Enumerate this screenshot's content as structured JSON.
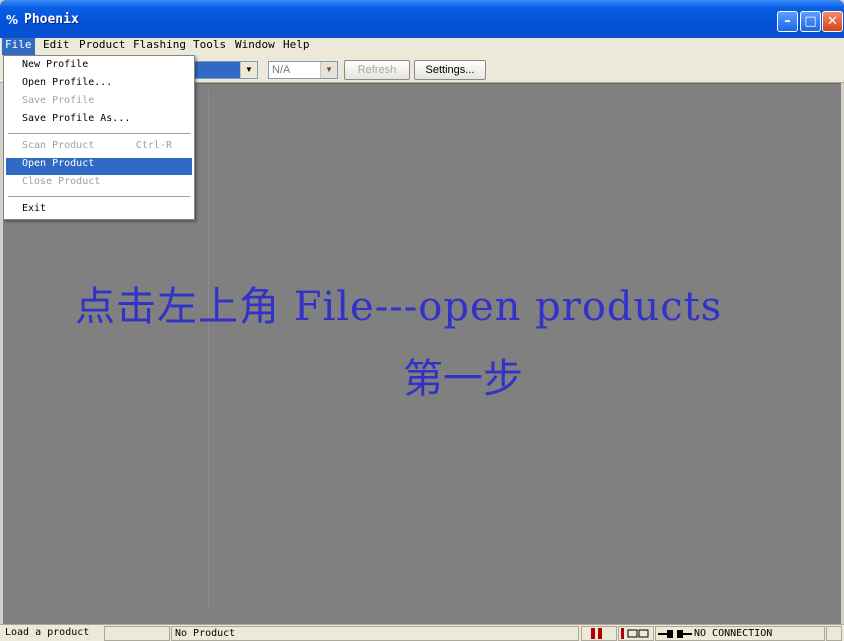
{
  "window": {
    "title": "Phoenix",
    "icon_text": "%"
  },
  "menubar": [
    {
      "label": "File",
      "active": true
    },
    {
      "label": "Edit"
    },
    {
      "label": "Product"
    },
    {
      "label": "Flashing"
    },
    {
      "label": "Tools"
    },
    {
      "label": "Window"
    },
    {
      "label": "Help"
    }
  ],
  "toolbar": {
    "port_value": "N/A",
    "refresh_label": "Refresh",
    "settings_label": "Settings..."
  },
  "file_menu": {
    "items": [
      {
        "label": "New Profile",
        "disabled": false
      },
      {
        "label": "Open Profile...",
        "disabled": false
      },
      {
        "label": "Save Profile",
        "disabled": true
      },
      {
        "label": "Save Profile As...",
        "disabled": false
      },
      {
        "label": "Scan Product",
        "shortcut": "Ctrl-R",
        "disabled": true
      },
      {
        "label": "Open Product",
        "disabled": false,
        "highlighted": true
      },
      {
        "label": "Close Product",
        "disabled": true
      },
      {
        "label": "Exit",
        "disabled": false
      }
    ]
  },
  "overlay": {
    "line1": "点击左上角 File---open products",
    "line2": "第一步"
  },
  "statusbar": {
    "message": "Load a product",
    "product": "No Product",
    "connection": "NO CONNECTION"
  },
  "colors": {
    "title_blue": "#0453d9",
    "highlight": "#316ac5",
    "overlay_text": "#3232c8",
    "workspace": "#808080"
  }
}
